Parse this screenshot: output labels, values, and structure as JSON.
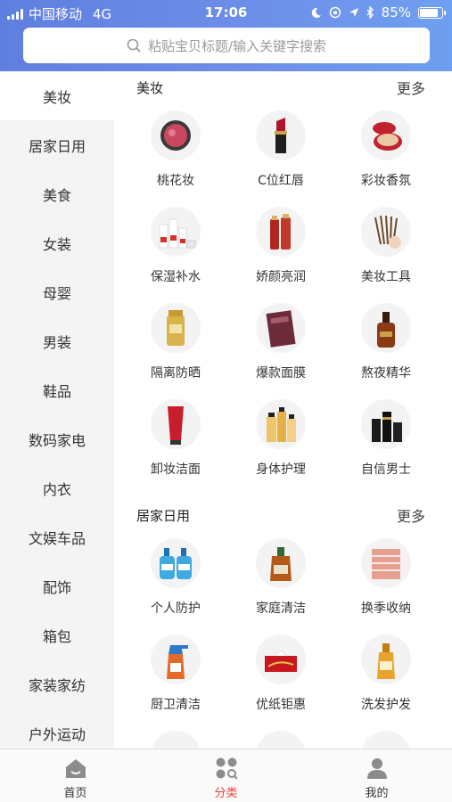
{
  "status_bar": {
    "carrier": "中国移动",
    "network": "4G",
    "time": "17:06",
    "battery": "85%",
    "battery_level": 0.85,
    "icons": [
      "signal-icon",
      "moon-icon",
      "orientation-lock-icon",
      "location-icon",
      "bluetooth-icon",
      "battery-icon"
    ]
  },
  "search": {
    "placeholder": "粘贴宝贝标题/输入关键字搜索",
    "icon": "search-icon"
  },
  "sidebar": {
    "items": [
      {
        "label": "美妆",
        "active": true
      },
      {
        "label": "居家日用"
      },
      {
        "label": "美食"
      },
      {
        "label": "女装"
      },
      {
        "label": "母婴"
      },
      {
        "label": "男装"
      },
      {
        "label": "鞋品"
      },
      {
        "label": "数码家电"
      },
      {
        "label": "内衣"
      },
      {
        "label": "文娱车品"
      },
      {
        "label": "配饰"
      },
      {
        "label": "箱包"
      },
      {
        "label": "家装家纺"
      },
      {
        "label": "户外运动"
      }
    ]
  },
  "sections": [
    {
      "title": "美妆",
      "more": "更多",
      "items": [
        {
          "label": "桃花妆",
          "icon": "blush-compact-icon"
        },
        {
          "label": "C位红唇",
          "icon": "lipstick-icon"
        },
        {
          "label": "彩妆香氛",
          "icon": "cushion-compact-icon"
        },
        {
          "label": "保湿补水",
          "icon": "skincare-set-icon"
        },
        {
          "label": "娇颜亮润",
          "icon": "toner-bottles-icon"
        },
        {
          "label": "美妆工具",
          "icon": "makeup-brushes-icon"
        },
        {
          "label": "隔离防晒",
          "icon": "sunscreen-icon"
        },
        {
          "label": "爆款面膜",
          "icon": "face-mask-icon"
        },
        {
          "label": "熬夜精华",
          "icon": "serum-bottle-icon"
        },
        {
          "label": "卸妆洁面",
          "icon": "cleanser-tube-icon"
        },
        {
          "label": "身体护理",
          "icon": "body-care-bottles-icon"
        },
        {
          "label": "自信男士",
          "icon": "mens-skincare-icon"
        }
      ]
    },
    {
      "title": "居家日用",
      "more": "更多",
      "items": [
        {
          "label": "个人防护",
          "icon": "hand-sanitizer-icon"
        },
        {
          "label": "家庭清洁",
          "icon": "disinfectant-bottle-icon"
        },
        {
          "label": "换季收纳",
          "icon": "storage-drawers-icon"
        },
        {
          "label": "厨卫清洁",
          "icon": "spray-cleaner-icon"
        },
        {
          "label": "优纸钜惠",
          "icon": "tissue-box-icon"
        },
        {
          "label": "洗发护发",
          "icon": "shampoo-bottle-icon"
        }
      ]
    }
  ],
  "tabbar": {
    "items": [
      {
        "label": "首页",
        "icon": "home-icon"
      },
      {
        "label": "分类",
        "icon": "category-icon",
        "active": true
      },
      {
        "label": "我的",
        "icon": "user-icon"
      }
    ]
  },
  "colors": {
    "header_start": "#5f7fe0",
    "header_end": "#6f9ff0",
    "active_tab": "#e8413b",
    "sidebar_bg": "#f4f4f4"
  }
}
